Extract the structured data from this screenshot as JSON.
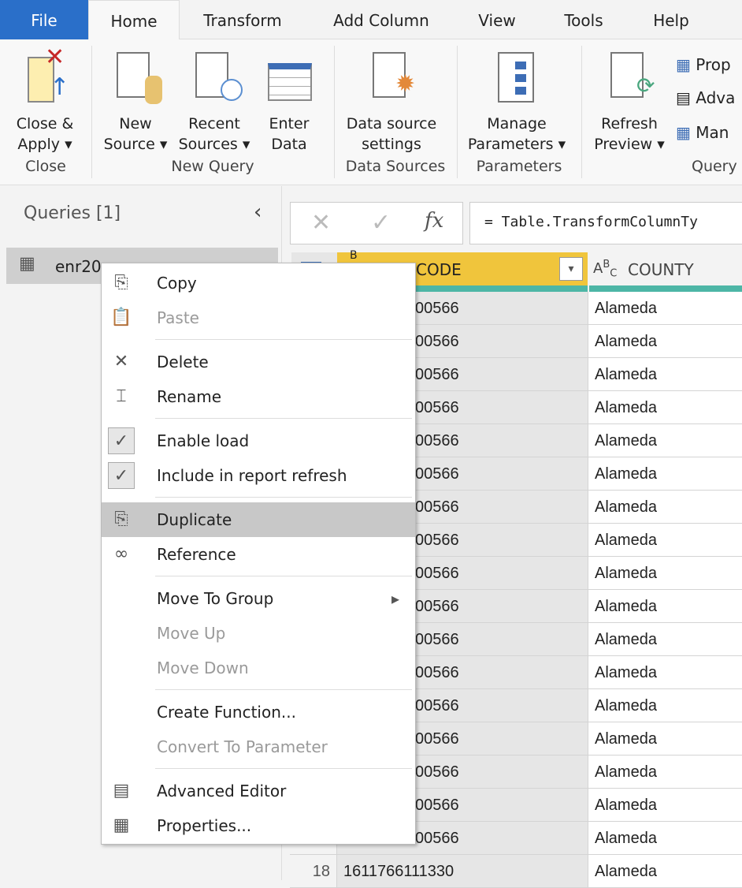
{
  "tabs": [
    "File",
    "Home",
    "Transform",
    "Add Column",
    "View",
    "Tools",
    "Help"
  ],
  "ribbon": {
    "close_apply": "Close &",
    "close_apply2": "Apply",
    "new_source": "New",
    "new_source2": "Source",
    "recent": "Recent",
    "recent2": "Sources",
    "enter": "Enter",
    "enter2": "Data",
    "dss": "Data source",
    "dss2": "settings",
    "manage": "Manage",
    "manage2": "Parameters",
    "refresh": "Refresh",
    "refresh2": "Preview",
    "properties": "Prop",
    "advanced": "Adva",
    "manage_small": "Man",
    "groups": [
      "Close",
      "New Query",
      "Data Sources",
      "Parameters",
      "Query"
    ]
  },
  "queries": {
    "title": "Queries [1]",
    "item": "enr20"
  },
  "formula": {
    "fx": "fx",
    "text": "= Table.TransformColumnTy"
  },
  "columns": [
    {
      "name": "CODE",
      "type": "B"
    },
    {
      "name": "COUNTY",
      "type": "ABC"
    }
  ],
  "rows": [
    {
      "code": "00566",
      "county": "Alameda"
    },
    {
      "code": "00566",
      "county": "Alameda"
    },
    {
      "code": "00566",
      "county": "Alameda"
    },
    {
      "code": "00566",
      "county": "Alameda"
    },
    {
      "code": "00566",
      "county": "Alameda"
    },
    {
      "code": "00566",
      "county": "Alameda"
    },
    {
      "code": "00566",
      "county": "Alameda"
    },
    {
      "code": "00566",
      "county": "Alameda"
    },
    {
      "code": "00566",
      "county": "Alameda"
    },
    {
      "code": "00566",
      "county": "Alameda"
    },
    {
      "code": "00566",
      "county": "Alameda"
    },
    {
      "code": "00566",
      "county": "Alameda"
    },
    {
      "code": "00566",
      "county": "Alameda"
    },
    {
      "code": "00566",
      "county": "Alameda"
    },
    {
      "code": "00566",
      "county": "Alameda"
    },
    {
      "code": "00566",
      "county": "Alameda"
    },
    {
      "code": "00566",
      "county": "Alameda"
    },
    {
      "num": "18",
      "code": "1611766111330",
      "county": "Alameda"
    }
  ],
  "menu": [
    {
      "label": "Copy",
      "icon": "copy-icon",
      "enabled": true
    },
    {
      "label": "Paste",
      "icon": "paste-icon",
      "enabled": false
    },
    {
      "label": "Delete",
      "icon": "delete-icon",
      "enabled": true
    },
    {
      "label": "Rename",
      "icon": "rename-icon",
      "enabled": true
    },
    {
      "label": "Enable load",
      "icon": "check-icon",
      "enabled": true,
      "checked": true
    },
    {
      "label": "Include in report refresh",
      "icon": "check-icon",
      "enabled": true,
      "checked": true
    },
    {
      "label": "Duplicate",
      "icon": "duplicate-icon",
      "enabled": true,
      "highlighted": true
    },
    {
      "label": "Reference",
      "icon": "link-icon",
      "enabled": true
    },
    {
      "label": "Move To Group",
      "enabled": true,
      "submenu": true
    },
    {
      "label": "Move Up",
      "enabled": false
    },
    {
      "label": "Move Down",
      "enabled": false
    },
    {
      "label": "Create Function...",
      "enabled": true
    },
    {
      "label": "Convert To Parameter",
      "enabled": false
    },
    {
      "label": "Advanced Editor",
      "icon": "script-icon",
      "enabled": true
    },
    {
      "label": "Properties...",
      "icon": "properties-icon",
      "enabled": true
    }
  ],
  "colors": {
    "accent": "#2a6fc9",
    "column_header": "#f0c53c",
    "quality_bar": "#4db6a6",
    "highlight": "#c8c8c8"
  }
}
